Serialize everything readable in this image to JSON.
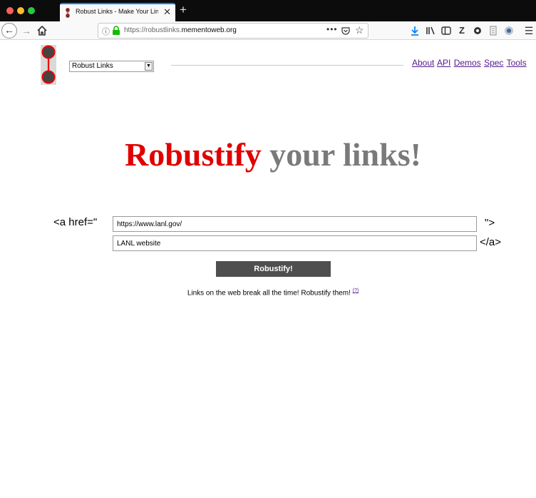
{
  "browser": {
    "tab_title": "Robust Links - Make Your Link Robust",
    "new_tab_symbol": "+",
    "url_prefix": "https://robustlinks.",
    "url_domain": "mementoweb.org",
    "url_more": "•••"
  },
  "page": {
    "site_select_value": "Robust Links",
    "nav": {
      "about": "About",
      "api": "API",
      "demos": "Demos",
      "spec": "Spec",
      "tools": "Tools"
    },
    "hero": {
      "accent": "Robustify",
      "rest": "your links!"
    },
    "form": {
      "prefix": "<a href=\"",
      "mid": "\">",
      "suffix": "</a>",
      "url_value": "https://www.lanl.gov/",
      "text_value": "LANL website",
      "submit_label": "Robustify!"
    },
    "tagline": {
      "text": "Links on the web break all the time! Robustify them!",
      "help": "(?)"
    }
  },
  "colors": {
    "accent_red": "#e00000",
    "hero_gray": "#7a7a7a",
    "link_purple": "#551a8b",
    "button_gray": "#4f4f4f"
  }
}
